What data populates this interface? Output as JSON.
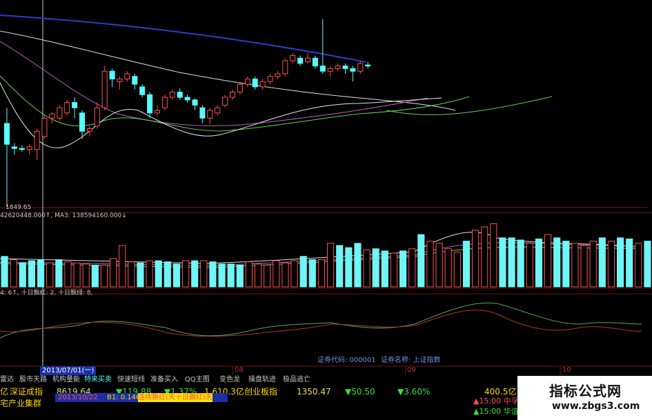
{
  "colors": {
    "background": "#000000",
    "up": "#ff5050",
    "down": "#54ffff",
    "volume_down": "#6ff5f5",
    "divider": "#7a1010",
    "ma_white": "#e0e0e0",
    "ma_purple": "#c060c0",
    "ma_green": "#5fd25f",
    "ma_blue": "#2b3fc8",
    "tab_text": "#c8c8c8",
    "logo_bg": "#ffffff"
  },
  "price_panel": {
    "low_label": "1849.65",
    "indicator_line": "42620448.000↑, MA3: 138594160.000↓"
  },
  "volume_panel": {
    "indicator_line": "4: 6↑, 十日飘红: 2, 十日飘绿: 8,"
  },
  "info_line": {
    "code_label": "证券代码:",
    "code_value": "000001",
    "name_label": "证券名称:",
    "name_value": "上证指数"
  },
  "date_cursor": "2013/07/01(一)",
  "month_markers": [
    "08",
    "09",
    "10"
  ],
  "tabs": [
    "雷达",
    "股市天路",
    "机构量能",
    "特来买卖",
    "快速短线",
    "准备买入",
    "QQ主图",
    "变色龙",
    "操盘轨迹",
    "极品逃亡"
  ],
  "ticker": {
    "row1": {
      "prefix": "亿",
      "name1": "深证成指",
      "value1": "8619.64",
      "change1": "▼119.88",
      "pct1": "▼1.37%",
      "amount1": "1,610.3亿",
      "name2": "创业板指",
      "value2": "1350.47",
      "change2": "▼50.50",
      "pct2": "▼3.60%",
      "amount2": "400.5亿"
    },
    "row2": {
      "sector": "宅产业集群",
      "date": "2013/10/22",
      "b1": "B1: 0.146",
      "signal": "连续飘红(天十日飘红)天"
    },
    "right": {
      "line1": "▲15:00 中孚",
      "line2": "▲15:00 华谊"
    }
  },
  "watermark": {
    "title": "指标公式网",
    "url": "www.zbgs3.com"
  },
  "chart_data": {
    "type": "candlestick",
    "candles": [
      {
        "o": 2000,
        "c": 1960,
        "h": 2030,
        "l": 1860
      },
      {
        "o": 1955,
        "c": 1952,
        "h": 1962,
        "l": 1940
      },
      {
        "o": 1952,
        "c": 1950,
        "h": 1958,
        "l": 1945
      },
      {
        "o": 1950,
        "c": 1955,
        "h": 1960,
        "l": 1940
      },
      {
        "o": 1950,
        "c": 1985,
        "h": 1990,
        "l": 1930
      },
      {
        "o": 1975,
        "c": 2010,
        "h": 2015,
        "l": 1970
      },
      {
        "o": 2010,
        "c": 2018,
        "h": 2022,
        "l": 2000
      },
      {
        "o": 2010,
        "c": 2030,
        "h": 2035,
        "l": 2005
      },
      {
        "o": 2020,
        "c": 2040,
        "h": 2045,
        "l": 2015
      },
      {
        "o": 2040,
        "c": 2030,
        "h": 2050,
        "l": 2010
      },
      {
        "o": 2020,
        "c": 1985,
        "h": 2025,
        "l": 1970
      },
      {
        "o": 1985,
        "c": 1990,
        "h": 1995,
        "l": 1975
      },
      {
        "o": 1995,
        "c": 2030,
        "h": 2040,
        "l": 1990
      },
      {
        "o": 2030,
        "c": 2100,
        "h": 2110,
        "l": 2025
      },
      {
        "o": 2100,
        "c": 2085,
        "h": 2105,
        "l": 2070
      },
      {
        "o": 2080,
        "c": 2085,
        "h": 2090,
        "l": 2065
      },
      {
        "o": 2085,
        "c": 2095,
        "h": 2100,
        "l": 2080
      },
      {
        "o": 2090,
        "c": 2075,
        "h": 2095,
        "l": 2065
      },
      {
        "o": 2070,
        "c": 2055,
        "h": 2075,
        "l": 2050
      },
      {
        "o": 2055,
        "c": 2020,
        "h": 2060,
        "l": 2010
      },
      {
        "o": 2020,
        "c": 2025,
        "h": 2035,
        "l": 2015
      },
      {
        "o": 2030,
        "c": 2050,
        "h": 2055,
        "l": 2025
      },
      {
        "o": 2050,
        "c": 2060,
        "h": 2065,
        "l": 2045
      },
      {
        "o": 2060,
        "c": 2050,
        "h": 2068,
        "l": 2045
      },
      {
        "o": 2050,
        "c": 2045,
        "h": 2055,
        "l": 2040
      },
      {
        "o": 2045,
        "c": 2035,
        "h": 2048,
        "l": 2025
      },
      {
        "o": 2030,
        "c": 2010,
        "h": 2035,
        "l": 2000
      },
      {
        "o": 2010,
        "c": 2025,
        "h": 2030,
        "l": 2000
      },
      {
        "o": 2020,
        "c": 2030,
        "h": 2035,
        "l": 2015
      },
      {
        "o": 2035,
        "c": 2050,
        "h": 2055,
        "l": 2030
      },
      {
        "o": 2050,
        "c": 2060,
        "h": 2065,
        "l": 2045
      },
      {
        "o": 2060,
        "c": 2075,
        "h": 2080,
        "l": 2055
      },
      {
        "o": 2075,
        "c": 2085,
        "h": 2090,
        "l": 2070
      },
      {
        "o": 2085,
        "c": 2070,
        "h": 2090,
        "l": 2065
      },
      {
        "o": 2070,
        "c": 2080,
        "h": 2085,
        "l": 2065
      },
      {
        "o": 2080,
        "c": 2090,
        "h": 2095,
        "l": 2075
      },
      {
        "o": 2090,
        "c": 2095,
        "h": 2100,
        "l": 2085
      },
      {
        "o": 2095,
        "c": 2120,
        "h": 2125,
        "l": 2090
      },
      {
        "o": 2120,
        "c": 2130,
        "h": 2135,
        "l": 2115
      },
      {
        "o": 2125,
        "c": 2115,
        "h": 2130,
        "l": 2110
      },
      {
        "o": 2118,
        "c": 2125,
        "h": 2135,
        "l": 2115
      },
      {
        "o": 2125,
        "c": 2110,
        "h": 2130,
        "l": 2105
      },
      {
        "o": 2110,
        "c": 2100,
        "h": 2200,
        "l": 2095
      },
      {
        "o": 2100,
        "c": 2105,
        "h": 2110,
        "l": 2090
      },
      {
        "o": 2105,
        "c": 2110,
        "h": 2115,
        "l": 2100
      },
      {
        "o": 2110,
        "c": 2105,
        "h": 2115,
        "l": 2095
      },
      {
        "o": 2105,
        "c": 2100,
        "h": 2110,
        "l": 2080
      },
      {
        "o": 2100,
        "c": 2115,
        "h": 2120,
        "l": 2095
      },
      {
        "o": 2112,
        "c": 2110,
        "h": 2118,
        "l": 2105
      }
    ],
    "volumes": [
      {
        "v": 28,
        "up": false
      },
      {
        "v": 25,
        "up": true
      },
      {
        "v": 22,
        "up": false
      },
      {
        "v": 24,
        "up": false
      },
      {
        "v": 25,
        "up": false
      },
      {
        "v": 22,
        "up": true
      },
      {
        "v": 25,
        "up": false
      },
      {
        "v": 23,
        "up": true
      },
      {
        "v": 22,
        "up": true
      },
      {
        "v": 21,
        "up": true
      },
      {
        "v": 20,
        "up": false
      },
      {
        "v": 20,
        "up": true
      },
      {
        "v": 26,
        "up": true
      },
      {
        "v": 38,
        "up": true
      },
      {
        "v": 23,
        "up": true
      },
      {
        "v": 22,
        "up": false
      },
      {
        "v": 24,
        "up": true
      },
      {
        "v": 24,
        "up": false
      },
      {
        "v": 23,
        "up": false
      },
      {
        "v": 21,
        "up": false
      },
      {
        "v": 24,
        "up": true
      },
      {
        "v": 24,
        "up": false
      },
      {
        "v": 24,
        "up": true
      },
      {
        "v": 23,
        "up": false
      },
      {
        "v": 21,
        "up": false
      },
      {
        "v": 21,
        "up": false
      },
      {
        "v": 20,
        "up": false
      },
      {
        "v": 23,
        "up": true
      },
      {
        "v": 21,
        "up": true
      },
      {
        "v": 20,
        "up": true
      },
      {
        "v": 24,
        "up": true
      },
      {
        "v": 22,
        "up": true
      },
      {
        "v": 24,
        "up": true
      },
      {
        "v": 28,
        "up": false
      },
      {
        "v": 25,
        "up": false
      },
      {
        "v": 25,
        "up": true
      },
      {
        "v": 40,
        "up": true
      },
      {
        "v": 38,
        "up": false
      },
      {
        "v": 36,
        "up": false
      },
      {
        "v": 40,
        "up": false
      },
      {
        "v": 34,
        "up": true
      },
      {
        "v": 35,
        "up": false
      },
      {
        "v": 33,
        "up": false
      },
      {
        "v": 31,
        "up": true
      },
      {
        "v": 33,
        "up": false
      },
      {
        "v": 35,
        "up": true
      },
      {
        "v": 48,
        "up": false
      },
      {
        "v": 42,
        "up": true
      },
      {
        "v": 40,
        "up": true
      },
      {
        "v": 35,
        "up": true
      },
      {
        "v": 32,
        "up": true
      },
      {
        "v": 42,
        "up": false
      },
      {
        "v": 52,
        "up": true
      },
      {
        "v": 55,
        "up": true
      },
      {
        "v": 58,
        "up": true
      },
      {
        "v": 45,
        "up": false
      },
      {
        "v": 45,
        "up": false
      },
      {
        "v": 43,
        "up": false
      },
      {
        "v": 40,
        "up": true
      },
      {
        "v": 44,
        "up": false
      },
      {
        "v": 48,
        "up": true
      },
      {
        "v": 45,
        "up": false
      },
      {
        "v": 42,
        "up": false
      },
      {
        "v": 40,
        "up": true
      },
      {
        "v": 38,
        "up": true
      },
      {
        "v": 42,
        "up": true
      },
      {
        "v": 45,
        "up": false
      },
      {
        "v": 42,
        "up": true
      },
      {
        "v": 45,
        "up": false
      },
      {
        "v": 44,
        "up": false
      },
      {
        "v": 40,
        "up": true
      },
      {
        "v": 42,
        "up": false
      }
    ]
  }
}
